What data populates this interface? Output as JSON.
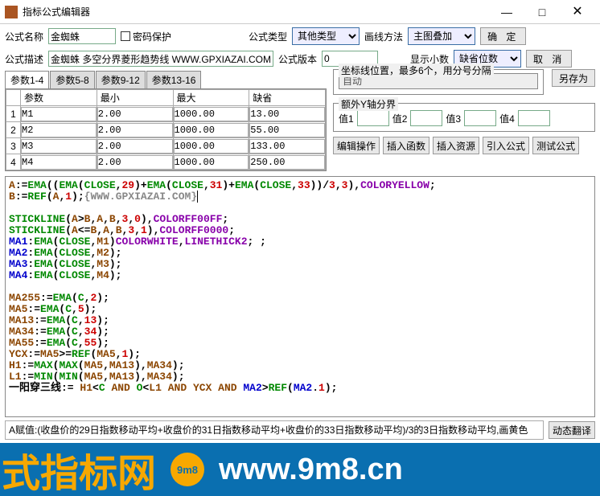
{
  "window": {
    "title": "指标公式编辑器"
  },
  "labels": {
    "name": "公式名称",
    "pwd": "密码保护",
    "type": "公式类型",
    "draw": "画线方法",
    "desc": "公式描述",
    "ver": "公式版本",
    "dec": "显示小数",
    "coord": "坐标线位置，最多6个，用分号分隔",
    "extra_y": "额外Y轴分界",
    "v1": "值1",
    "v2": "值2",
    "v3": "值3",
    "v4": "值4"
  },
  "fields": {
    "name_val": "金蜘蛛",
    "desc_val": "金蜘蛛 多空分界菱形趋势线 WWW.GPXIAZAI.COM",
    "type_sel": "其他类型",
    "draw_sel": "主图叠加",
    "ver_val": "0",
    "dec_sel": "缺省位数",
    "coord_val": "自动"
  },
  "buttons": {
    "ok": "确 定",
    "cancel": "取 消",
    "saveas": "另存为",
    "editop": "编辑操作",
    "insfn": "插入函数",
    "insres": "插入资源",
    "import": "引入公式",
    "test": "测试公式",
    "autotr": "动态翻译"
  },
  "tabs": [
    "参数1-4",
    "参数5-8",
    "参数9-12",
    "参数13-16"
  ],
  "params": {
    "headers": [
      "参数",
      "最小",
      "最大",
      "缺省"
    ],
    "rows": [
      {
        "i": "1",
        "n": "M1",
        "min": "2.00",
        "max": "1000.00",
        "def": "13.00"
      },
      {
        "i": "2",
        "n": "M2",
        "min": "2.00",
        "max": "1000.00",
        "def": "55.00"
      },
      {
        "i": "3",
        "n": "M3",
        "min": "2.00",
        "max": "1000.00",
        "def": "133.00"
      },
      {
        "i": "4",
        "n": "M4",
        "min": "2.00",
        "max": "1000.00",
        "def": "250.00"
      }
    ]
  },
  "status": "A赋值:(收盘价的29日指数移动平均+收盘价的31日指数移动平均+收盘价的33日指数移动平均)/3的3日指数移动平均,画黄色",
  "banner": {
    "left": "式指标网",
    "url": "www.9m8.cn"
  }
}
